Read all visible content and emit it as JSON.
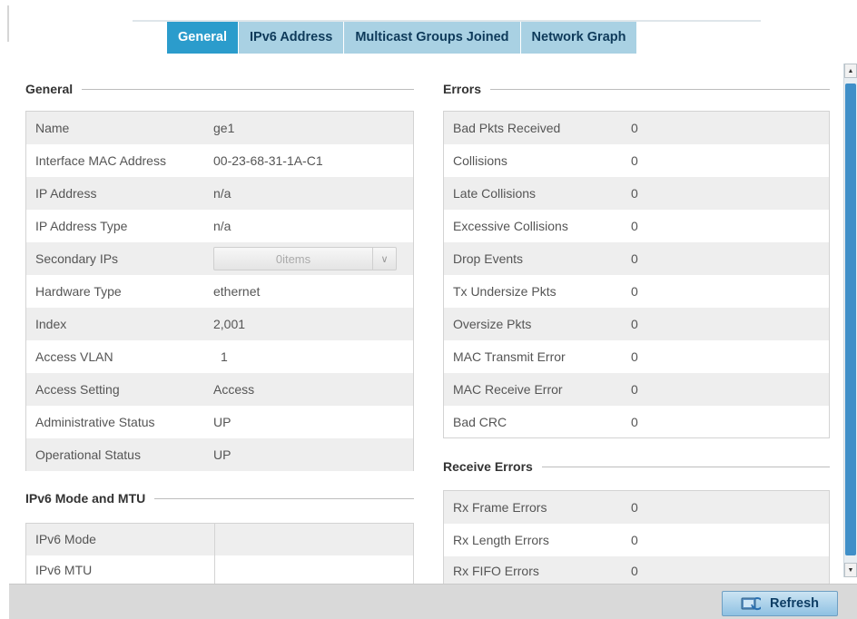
{
  "tabs": [
    {
      "label": "General",
      "active": true
    },
    {
      "label": "IPv6 Address",
      "active": false
    },
    {
      "label": "Multicast Groups Joined",
      "active": false
    },
    {
      "label": "Network Graph",
      "active": false
    }
  ],
  "general": {
    "title": "General",
    "rows": [
      {
        "label": "Name",
        "value": "ge1"
      },
      {
        "label": "Interface MAC Address",
        "value": "00-23-68-31-1A-C1"
      },
      {
        "label": "IP Address",
        "value": "n/a"
      },
      {
        "label": "IP Address Type",
        "value": "n/a"
      },
      {
        "label": "Secondary IPs",
        "value": "0items"
      },
      {
        "label": "Hardware Type",
        "value": "ethernet"
      },
      {
        "label": "Index",
        "value": "2,001"
      },
      {
        "label": "Access VLAN",
        "value": "1"
      },
      {
        "label": "Access Setting",
        "value": "Access"
      },
      {
        "label": "Administrative Status",
        "value": "UP"
      },
      {
        "label": "Operational Status",
        "value": "UP"
      }
    ]
  },
  "ipv6": {
    "title": "IPv6 Mode and MTU",
    "rows": [
      {
        "label": "IPv6 Mode",
        "value": ""
      },
      {
        "label": "IPv6 MTU",
        "value": ""
      }
    ]
  },
  "errors": {
    "title": "Errors",
    "rows": [
      {
        "label": "Bad Pkts Received",
        "value": "0"
      },
      {
        "label": "Collisions",
        "value": "0"
      },
      {
        "label": "Late Collisions",
        "value": "0"
      },
      {
        "label": "Excessive Collisions",
        "value": "0"
      },
      {
        "label": "Drop Events",
        "value": "0"
      },
      {
        "label": "Tx Undersize Pkts",
        "value": "0"
      },
      {
        "label": "Oversize Pkts",
        "value": "0"
      },
      {
        "label": "MAC Transmit Error",
        "value": "0"
      },
      {
        "label": "MAC Receive Error",
        "value": "0"
      },
      {
        "label": "Bad CRC",
        "value": "0"
      }
    ]
  },
  "receive_errors": {
    "title": "Receive Errors",
    "rows": [
      {
        "label": "Rx Frame Errors",
        "value": "0"
      },
      {
        "label": "Rx Length Errors",
        "value": "0"
      },
      {
        "label": "Rx FIFO Errors",
        "value": "0"
      }
    ]
  },
  "footer": {
    "refresh_label": "Refresh",
    "refresh_icon": "refresh-icon"
  },
  "colors": {
    "active_tab": "#2b9ccc",
    "inactive_tab": "#a9d1e3",
    "scroll_thumb": "#3f8fc8"
  }
}
